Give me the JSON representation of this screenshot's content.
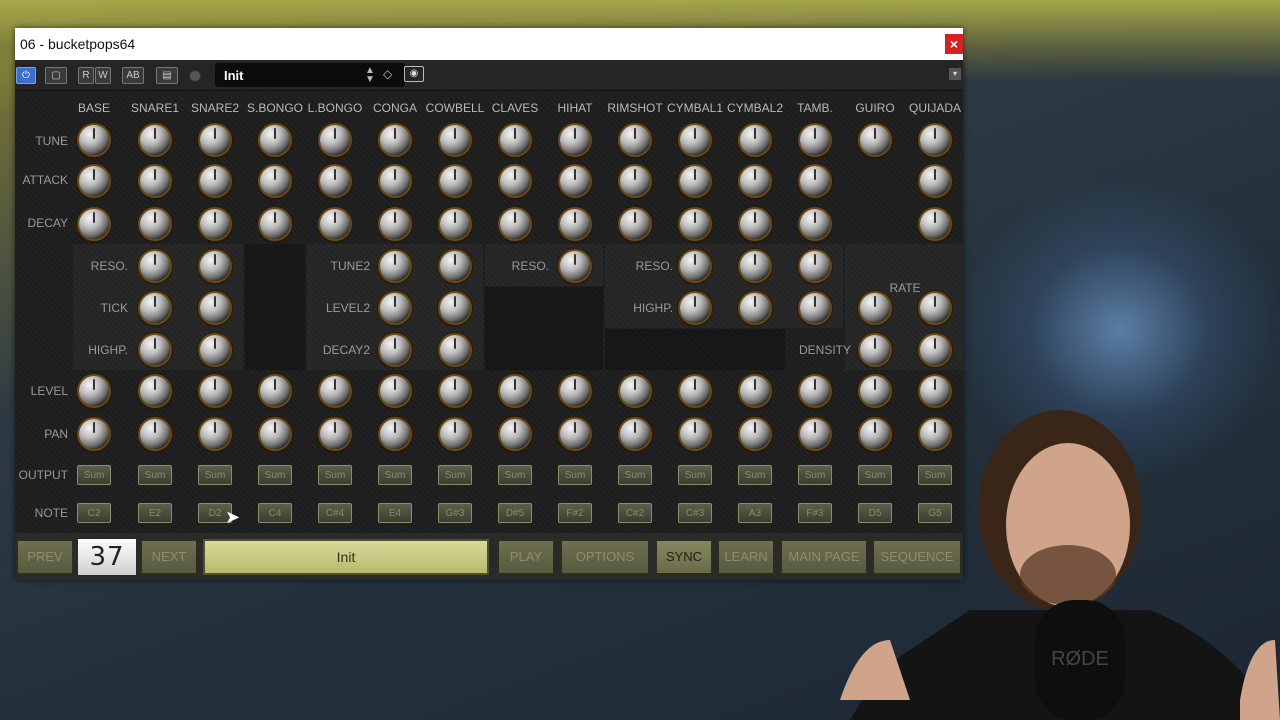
{
  "window": {
    "title": "06 - bucketpops64",
    "close_label": "×"
  },
  "toolbar": {
    "buttons": [
      "R",
      "W",
      "AB"
    ],
    "preset_name": "Init",
    "menu_label": "▾"
  },
  "columns": [
    "BASE",
    "SNARE1",
    "SNARE2",
    "S.BONGO",
    "L.BONGO",
    "CONGA",
    "COWBELL",
    "CLAVES",
    "HIHAT",
    "RIMSHOT",
    "CYMBAL1",
    "CYMBAL2",
    "TAMB.",
    "GUIRO",
    "QUIJADA"
  ],
  "rows": {
    "tune": "TUNE",
    "attack": "ATTACK",
    "decay": "DECAY",
    "level": "LEVEL",
    "pan": "PAN",
    "output": "OUTPUT",
    "note": "NOTE"
  },
  "extra_labels": {
    "snare_reso": "RESO.",
    "snare_tick": "TICK",
    "snare_highp": "HIGHP.",
    "conga_tune2": "TUNE2",
    "conga_level2": "LEVEL2",
    "conga_decay2": "DECAY2",
    "hihat_reso": "RESO.",
    "cymbal_reso": "RESO.",
    "cymbal_highp": "HIGHP.",
    "guiro_rate": "RATE",
    "guiro_density": "DENSITY"
  },
  "output_value": "Sum",
  "notes": [
    "C2",
    "E2",
    "D2",
    "C4",
    "C#4",
    "E4",
    "G#3",
    "D#5",
    "F#2",
    "C#2",
    "C#3",
    "A3",
    "F#3",
    "D5",
    "G5"
  ],
  "bottom": {
    "prev": "PREV",
    "counter": "37",
    "next": "NEXT",
    "preset": "Init",
    "play": "PLAY",
    "options": "OPTIONS",
    "sync": "SYNC",
    "learn": "LEARN",
    "main_page": "MAIN PAGE",
    "sequence": "SEQUENCE"
  },
  "mic_text": "RØDE"
}
